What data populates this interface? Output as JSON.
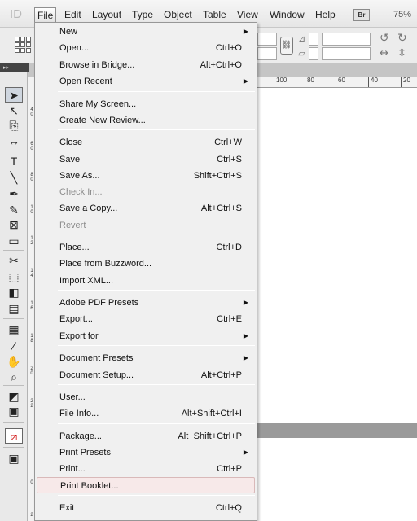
{
  "app": {
    "logo_text": "ID"
  },
  "menubar": {
    "items": [
      "File",
      "Edit",
      "Layout",
      "Type",
      "Object",
      "Table",
      "View",
      "Window",
      "Help"
    ],
    "bridge_badge": "Br",
    "zoom": "75%"
  },
  "h_ruler_ticks": [
    "100",
    "80",
    "60",
    "40",
    "20"
  ],
  "v_ruler_ticks": [
    "4 0",
    "6 0",
    "8 0",
    "1 0",
    "1 2",
    "1 4",
    "1 6",
    "1 8",
    "2 0",
    "2 2",
    "0",
    "2"
  ],
  "file_menu": {
    "items": [
      {
        "label": "New",
        "submenu": true
      },
      {
        "label": "Open...",
        "shortcut": "Ctrl+O"
      },
      {
        "label": "Browse in Bridge...",
        "shortcut": "Alt+Ctrl+O"
      },
      {
        "label": "Open Recent",
        "submenu": true
      },
      {
        "label": "Share My Screen..."
      },
      {
        "label": "Create New Review..."
      },
      {
        "label": "Close",
        "shortcut": "Ctrl+W"
      },
      {
        "label": "Save",
        "shortcut": "Ctrl+S"
      },
      {
        "label": "Save As...",
        "shortcut": "Shift+Ctrl+S"
      },
      {
        "label": "Check In...",
        "disabled": true
      },
      {
        "label": "Save a Copy...",
        "shortcut": "Alt+Ctrl+S"
      },
      {
        "label": "Revert",
        "disabled": true
      },
      {
        "label": "Place...",
        "shortcut": "Ctrl+D"
      },
      {
        "label": "Place from Buzzword..."
      },
      {
        "label": "Import XML..."
      },
      {
        "label": "Adobe PDF Presets",
        "submenu": true
      },
      {
        "label": "Export...",
        "shortcut": "Ctrl+E"
      },
      {
        "label": "Export for",
        "submenu": true
      },
      {
        "label": "Document Presets",
        "submenu": true
      },
      {
        "label": "Document Setup...",
        "shortcut": "Alt+Ctrl+P"
      },
      {
        "label": "User..."
      },
      {
        "label": "File Info...",
        "shortcut": "Alt+Shift+Ctrl+I"
      },
      {
        "label": "Package...",
        "shortcut": "Alt+Shift+Ctrl+P"
      },
      {
        "label": "Print Presets",
        "submenu": true
      },
      {
        "label": "Print...",
        "shortcut": "Ctrl+P"
      },
      {
        "label": "Print Booklet...",
        "highlighted": true
      },
      {
        "label": "Exit",
        "shortcut": "Ctrl+Q"
      }
    ]
  },
  "tools": [
    {
      "icon": "selection-tool-icon",
      "glyph": "➤"
    },
    {
      "icon": "direct-selection-tool-icon",
      "glyph": "↖"
    },
    {
      "icon": "page-tool-icon",
      "glyph": "⎘"
    },
    {
      "icon": "gap-tool-icon",
      "glyph": "↔"
    },
    {
      "icon": "type-tool-icon",
      "glyph": "T"
    },
    {
      "icon": "line-tool-icon",
      "glyph": "╲"
    },
    {
      "icon": "pen-tool-icon",
      "glyph": "✒"
    },
    {
      "icon": "pencil-tool-icon",
      "glyph": "✎"
    },
    {
      "icon": "rectangle-frame-tool-icon",
      "glyph": "⊠"
    },
    {
      "icon": "rectangle-tool-icon",
      "glyph": "▭"
    },
    {
      "icon": "scissors-tool-icon",
      "glyph": "✂"
    },
    {
      "icon": "free-transform-tool-icon",
      "glyph": "⬚"
    },
    {
      "icon": "gradient-swatch-tool-icon",
      "glyph": "◧"
    },
    {
      "icon": "gradient-feather-tool-icon",
      "glyph": "▤"
    },
    {
      "icon": "note-tool-icon",
      "glyph": "▦"
    },
    {
      "icon": "eyedropper-tool-icon",
      "glyph": "⁄"
    },
    {
      "icon": "hand-tool-icon",
      "glyph": "✋"
    },
    {
      "icon": "zoom-tool-icon",
      "glyph": "⌕"
    },
    {
      "icon": "fill-stroke-icon",
      "glyph": "◩"
    },
    {
      "icon": "formatting-affects-icon",
      "glyph": "▣"
    },
    {
      "icon": "apply-none-icon",
      "glyph": "⧄"
    },
    {
      "icon": "screen-mode-icon",
      "glyph": "▣"
    }
  ],
  "colors": {
    "menu_bg": "#f0f0f0",
    "highlight_bg": "#f7e9e9",
    "disabled_text": "#8c8c8c"
  }
}
